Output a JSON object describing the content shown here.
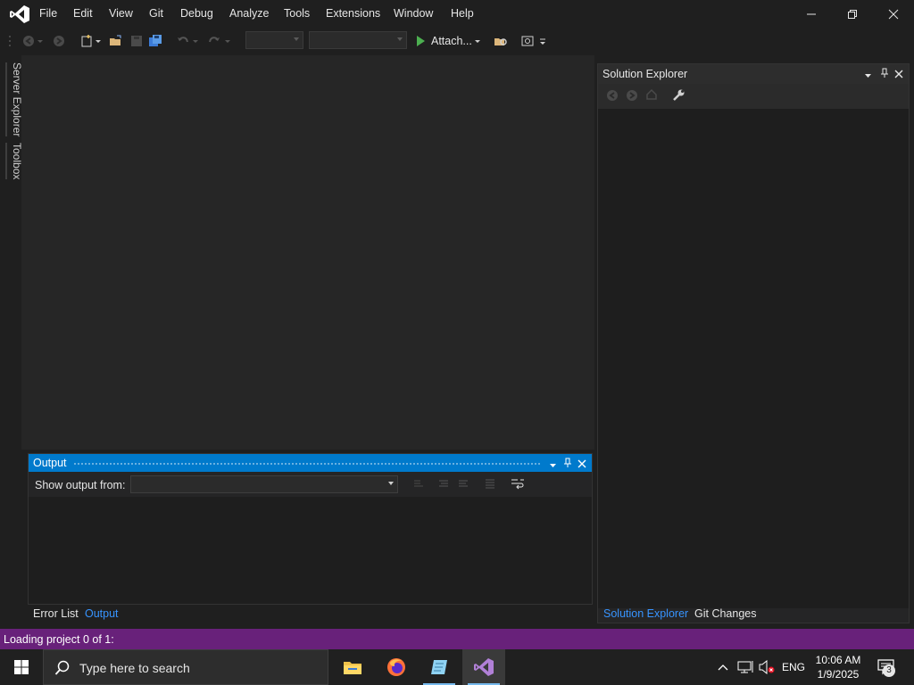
{
  "menu": {
    "items": [
      "File",
      "Edit",
      "View",
      "Git",
      "Debug",
      "Analyze",
      "Tools",
      "Extensions",
      "Window",
      "Help"
    ]
  },
  "toolbar": {
    "attach_label": "Attach..."
  },
  "left_rail": {
    "tabs": [
      "Server Explorer",
      "Toolbox"
    ]
  },
  "solution_explorer": {
    "title": "Solution Explorer"
  },
  "output": {
    "title": "Output",
    "show_output_from_label": "Show output from:",
    "source_value": ""
  },
  "bottom_tabs_left": {
    "error_list": "Error List",
    "output": "Output"
  },
  "bottom_tabs_right": {
    "solution_explorer": "Solution Explorer",
    "git_changes": "Git Changes"
  },
  "status": {
    "text": "Loading project 0 of 1:"
  },
  "taskbar": {
    "search_placeholder": "Type here to search",
    "language": "ENG",
    "time": "10:06 AM",
    "date": "1/9/2025",
    "notification_count": "3"
  },
  "colors": {
    "accent_blue": "#007acc",
    "status_purple": "#68217a",
    "active_tab_text": "#3794ff"
  }
}
